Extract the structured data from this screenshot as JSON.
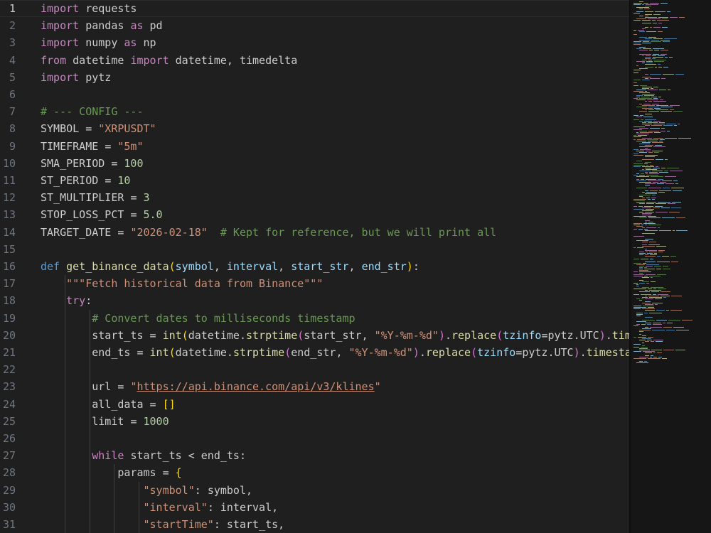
{
  "editor": {
    "language": "python",
    "active_line": 1,
    "colors": {
      "background": "#1f1f1f",
      "keyword": "#c586c0",
      "def_keyword": "#569cd6",
      "function": "#dcdcaa",
      "parameter": "#9cdcfe",
      "string": "#ce9178",
      "number": "#b5cea8",
      "comment": "#6a9955",
      "bracket_gold": "#ffd700",
      "bracket_purple": "#da70d6",
      "bracket_blue": "#179fff"
    },
    "lines": [
      {
        "num": "1",
        "text": "import requests"
      },
      {
        "num": "2",
        "text": "import pandas as pd"
      },
      {
        "num": "3",
        "text": "import numpy as np"
      },
      {
        "num": "4",
        "text": "from datetime import datetime, timedelta"
      },
      {
        "num": "5",
        "text": "import pytz"
      },
      {
        "num": "6",
        "text": ""
      },
      {
        "num": "7",
        "text": "# --- CONFIG ---"
      },
      {
        "num": "8",
        "text": "SYMBOL = \"XRPUSDT\""
      },
      {
        "num": "9",
        "text": "TIMEFRAME = \"5m\""
      },
      {
        "num": "10",
        "text": "SMA_PERIOD = 100"
      },
      {
        "num": "11",
        "text": "ST_PERIOD = 10"
      },
      {
        "num": "12",
        "text": "ST_MULTIPLIER = 3"
      },
      {
        "num": "13",
        "text": "STOP_LOSS_PCT = 5.0"
      },
      {
        "num": "14",
        "text": "TARGET_DATE = \"2026-02-18\"  # Kept for reference, but we will print all"
      },
      {
        "num": "15",
        "text": ""
      },
      {
        "num": "16",
        "text": "def get_binance_data(symbol, interval, start_str, end_str):"
      },
      {
        "num": "17",
        "text": "    \"\"\"Fetch historical data from Binance\"\"\""
      },
      {
        "num": "18",
        "text": "    try:"
      },
      {
        "num": "19",
        "text": "        # Convert dates to milliseconds timestamp"
      },
      {
        "num": "20",
        "text": "        start_ts = int(datetime.strptime(start_str, \"%Y-%m-%d\").replace(tzinfo=pytz.UTC).timestam"
      },
      {
        "num": "21",
        "text": "        end_ts = int(datetime.strptime(end_str, \"%Y-%m-%d\").replace(tzinfo=pytz.UTC).timestamp()"
      },
      {
        "num": "22",
        "text": ""
      },
      {
        "num": "23",
        "text": "        url = \"https://api.binance.com/api/v3/klines\""
      },
      {
        "num": "24",
        "text": "        all_data = []"
      },
      {
        "num": "25",
        "text": "        limit = 1000"
      },
      {
        "num": "26",
        "text": ""
      },
      {
        "num": "27",
        "text": "        while start_ts < end_ts:"
      },
      {
        "num": "28",
        "text": "            params = {"
      },
      {
        "num": "29",
        "text": "                \"symbol\": symbol,"
      },
      {
        "num": "30",
        "text": "                \"interval\": interval,"
      },
      {
        "num": "31",
        "text": "                \"startTime\": start_ts,"
      }
    ]
  }
}
